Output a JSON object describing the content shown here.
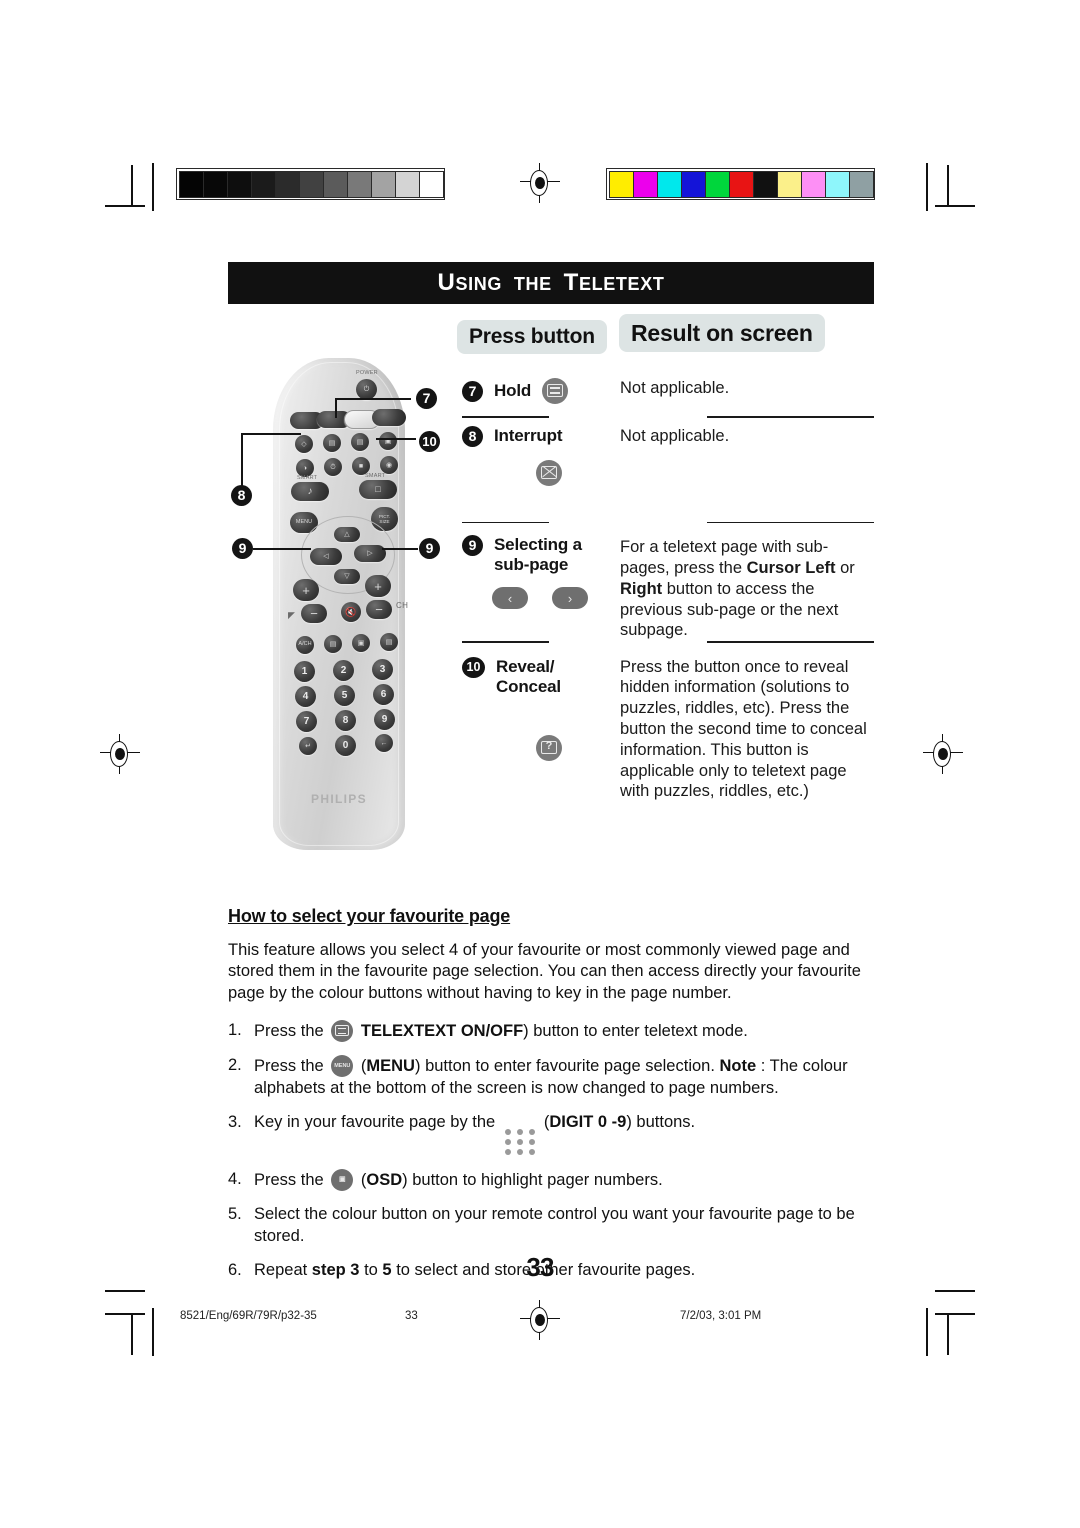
{
  "document": {
    "section_title": {
      "word1_cap": "U",
      "word1_rest": "SING",
      "word2": "THE",
      "word3_cap": "T",
      "word3_rest": "ELETEXT",
      "full": "USING THE TELETEXT"
    },
    "page_number": "33"
  },
  "columns": {
    "press_button": "Press button",
    "result_on_screen": "Result on screen"
  },
  "table": [
    {
      "number": "7",
      "label": "Hold",
      "icon": "hold-key-icon",
      "result": "Not applicable."
    },
    {
      "number": "8",
      "label": "Interrupt",
      "icon": "interrupt-key-icon",
      "result": "Not applicable."
    },
    {
      "number": "9",
      "label_line1": "Selecting a",
      "label_line2": "sub-page",
      "icons": [
        "cursor-left-key-icon",
        "cursor-right-key-icon"
      ],
      "result_parts": [
        {
          "t": "For a teletext page with sub-pages, press the ",
          "b": false
        },
        {
          "t": "Cursor Left",
          "b": true
        },
        {
          "t": " or ",
          "b": false
        },
        {
          "t": "Right",
          "b": true
        },
        {
          "t": " button to access the previous sub-page or the next subpage.",
          "b": false
        }
      ],
      "result_plain": "For a teletext page with sub-pages, press the Cursor Left or Right button to access the previous sub-page or the next subpage."
    },
    {
      "number": "10",
      "label_line1": "Reveal/",
      "label_line2": "Conceal",
      "icon": "reveal-conceal-key-icon",
      "result": "Press the button once to reveal hidden information (solutions to puzzles, riddles, etc). Press the button the second time to conceal information. This button is applicable only to teletext page with puzzles, riddles, etc.)"
    }
  ],
  "remote": {
    "brand": "PHILIPS",
    "power_label": "POWER",
    "smart_sound_label": "SMART",
    "smart_picture_label": "SMART",
    "ch_label": "CH",
    "menu_label": "MENU",
    "pip_label": "PICT. SIZE",
    "digits": [
      "1",
      "2",
      "3",
      "4",
      "5",
      "6",
      "7",
      "8",
      "9",
      "0"
    ],
    "callouts": [
      "7",
      "10",
      "8",
      "9",
      "9"
    ]
  },
  "favourite": {
    "heading": "How to select your favourite page",
    "intro": "This feature allows you select 4 of your favourite or most commonly viewed page and stored them in the favourite page selection. You can then access directly your favourite page by the colour buttons without having to key in the page number.",
    "steps": [
      {
        "n": "1.",
        "icon": "telextext-onoff-key-icon",
        "pre": "Press the ",
        "bold1": "TELEXTEXT ON/OFF",
        "post": ") button to enter teletext mode."
      },
      {
        "n": "2.",
        "icon": "menu-key-icon",
        "pre": "Press the ",
        "bold1": "MENU",
        "mid": ") button to enter favourite page selection. ",
        "bold2": "Note",
        "post": " : The colour alphabets at the bottom of the screen is now changed to page numbers.",
        "open": "("
      },
      {
        "n": "3.",
        "icon": "digit-pad-icon",
        "pre": "Key in your favourite page by the ",
        "bold1": "DIGIT 0 -9",
        "post": ") buttons.",
        "open": "("
      },
      {
        "n": "4.",
        "icon": "osd-key-icon",
        "pre": "Press the ",
        "bold1": "OSD",
        "post": ") button to highlight pager numbers.",
        "open": "("
      },
      {
        "n": "5.",
        "plain": "Select the colour button on your remote control you want your favourite page to be stored."
      },
      {
        "n": "6.",
        "pre": "Repeat ",
        "bold1": "step 3",
        "mid": " to ",
        "bold2": "5",
        "post": " to select and store other favourite pages."
      }
    ]
  },
  "footer": {
    "doc_id": "8521/Eng/69R/79R/p32-35",
    "page": "33",
    "date": "7/2/03, 3:01 PM"
  },
  "calibration": {
    "grey_swatches": [
      "#040404",
      "#080808",
      "#0e0e0e",
      "#1b1b1b",
      "#2b2b2b",
      "#414141",
      "#5b5b5b",
      "#797979",
      "#a3a3a3",
      "#d4d4d4",
      "#ffffff"
    ],
    "colour_swatches": [
      "#ffed00",
      "#ec00ec",
      "#00e8ec",
      "#1414d8",
      "#00d63c",
      "#e81414",
      "#111111",
      "#fbf08a",
      "#fd8ff5",
      "#8ef6fb",
      "#8fa0a3"
    ]
  }
}
